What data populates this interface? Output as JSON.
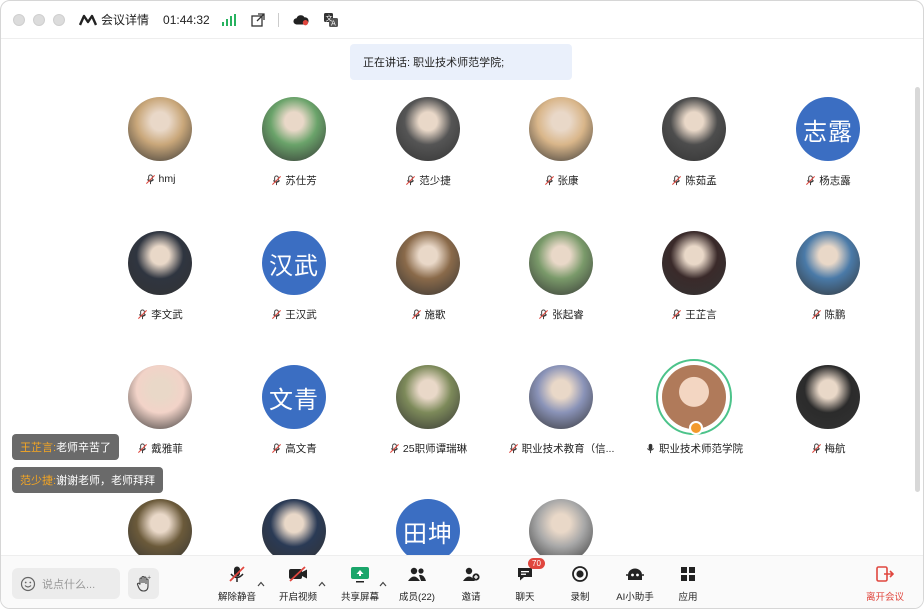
{
  "window": {
    "title": "会议详情",
    "clock": "01:44:32"
  },
  "speaking": {
    "text": "正在讲话: 职业技术师范学院;"
  },
  "participants": [
    {
      "name": "hmj",
      "initial": "",
      "color": "#c9a77a"
    },
    {
      "name": "苏仕芳",
      "initial": "",
      "color": "#6aa36a"
    },
    {
      "name": "范少捷",
      "initial": "",
      "color": "#555555"
    },
    {
      "name": "张康",
      "initial": "",
      "color": "#d9b68a"
    },
    {
      "name": "陈茹孟",
      "initial": "",
      "color": "#4d4d4d"
    },
    {
      "name": "杨志露",
      "initial": "志露",
      "color": "#3b6ec2"
    },
    {
      "name": "李文武",
      "initial": "",
      "color": "#2f3540"
    },
    {
      "name": "王汉武",
      "initial": "汉武",
      "color": "#3b6ec2"
    },
    {
      "name": "施歌",
      "initial": "",
      "color": "#8a6a4a"
    },
    {
      "name": "张起睿",
      "initial": "",
      "color": "#7a9a6a"
    },
    {
      "name": "王芷言",
      "initial": "",
      "color": "#3a2a2a"
    },
    {
      "name": "陈鹏",
      "initial": "",
      "color": "#4a7aa8"
    },
    {
      "name": "戴雅菲",
      "initial": "",
      "color": "#f2d3c8"
    },
    {
      "name": "高文青",
      "initial": "文青",
      "color": "#3b6ec2"
    },
    {
      "name": "25职师谭瑞琳",
      "initial": "",
      "color": "#7d8a5a"
    },
    {
      "name": "职业技术教育（信...",
      "initial": "",
      "color": "#8a93b8"
    },
    {
      "name": "职业技术师范学院",
      "initial": "",
      "color": "#b07a5a"
    },
    {
      "name": "梅航",
      "initial": "",
      "color": "#2b2b2b"
    },
    {
      "name": "",
      "initial": "",
      "color": "#6b5a3a"
    },
    {
      "name": "",
      "initial": "",
      "color": "#2a3a55"
    },
    {
      "name": "",
      "initial": "田坤",
      "color": "#3b6ec2"
    },
    {
      "name": "",
      "initial": "",
      "color": "#a8a8a8"
    }
  ],
  "chat": [
    {
      "who": "王芷言:",
      "text": "老师辛苦了"
    },
    {
      "who": "范少捷:",
      "text": "谢谢老师，老师拜拜"
    }
  ],
  "toolbar": {
    "say_placeholder": "说点什么...",
    "tools": [
      {
        "label": "解除静音",
        "icon": "mic-muted-icon"
      },
      {
        "label": "开启视频",
        "icon": "camera-off-icon"
      },
      {
        "label": "共享屏幕",
        "icon": "share-screen-icon"
      },
      {
        "label": "成员(22)",
        "icon": "members-icon"
      },
      {
        "label": "邀请",
        "icon": "invite-icon"
      },
      {
        "label": "聊天",
        "icon": "chat-icon",
        "badge": "70"
      },
      {
        "label": "录制",
        "icon": "record-icon"
      },
      {
        "label": "AI小助手",
        "icon": "ai-assistant-icon"
      },
      {
        "label": "应用",
        "icon": "apps-icon"
      }
    ],
    "leave": "离开会议"
  },
  "colors": {
    "accent": "#3b6ec2",
    "danger": "#e0463e",
    "speaking_ring": "#4cc38a"
  }
}
